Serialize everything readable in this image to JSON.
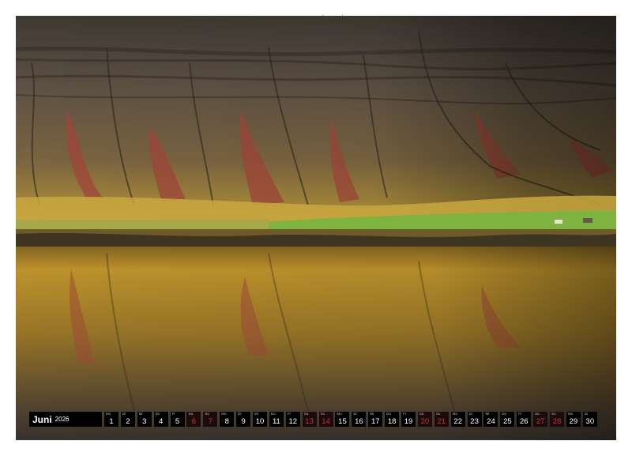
{
  "calendar": {
    "month": "Juni",
    "year": "2026",
    "days": [
      {
        "n": "1",
        "wd": "Mo"
      },
      {
        "n": "2",
        "wd": "Di"
      },
      {
        "n": "3",
        "wd": "Mi"
      },
      {
        "n": "4",
        "wd": "Do"
      },
      {
        "n": "5",
        "wd": "Fr"
      },
      {
        "n": "6",
        "wd": "Sa"
      },
      {
        "n": "7",
        "wd": "So"
      },
      {
        "n": "8",
        "wd": "Mo"
      },
      {
        "n": "9",
        "wd": "Di"
      },
      {
        "n": "10",
        "wd": "Mi"
      },
      {
        "n": "11",
        "wd": "Do"
      },
      {
        "n": "12",
        "wd": "Fr"
      },
      {
        "n": "13",
        "wd": "Sa"
      },
      {
        "n": "14",
        "wd": "So"
      },
      {
        "n": "15",
        "wd": "Mo"
      },
      {
        "n": "16",
        "wd": "Di"
      },
      {
        "n": "17",
        "wd": "Mi"
      },
      {
        "n": "18",
        "wd": "Do"
      },
      {
        "n": "19",
        "wd": "Fr"
      },
      {
        "n": "20",
        "wd": "Sa"
      },
      {
        "n": "21",
        "wd": "So"
      },
      {
        "n": "22",
        "wd": "Mo"
      },
      {
        "n": "23",
        "wd": "Di"
      },
      {
        "n": "24",
        "wd": "Mi"
      },
      {
        "n": "25",
        "wd": "Do"
      },
      {
        "n": "26",
        "wd": "Fr"
      },
      {
        "n": "27",
        "wd": "Sa"
      },
      {
        "n": "28",
        "wd": "So"
      },
      {
        "n": "29",
        "wd": "Mo"
      },
      {
        "n": "30",
        "wd": "Di"
      }
    ],
    "sunday_color": "#c7333d"
  },
  "photo": {
    "subject": "mountain-lake-reflection",
    "colors": {
      "mountain_dark": "#4a4238",
      "mountain_mid": "#6e5d45",
      "moss_red": "#a0453a",
      "grass_yellow": "#c9a840",
      "meadow_green": "#7fb33f",
      "water_gold": "#b98a2a"
    }
  }
}
